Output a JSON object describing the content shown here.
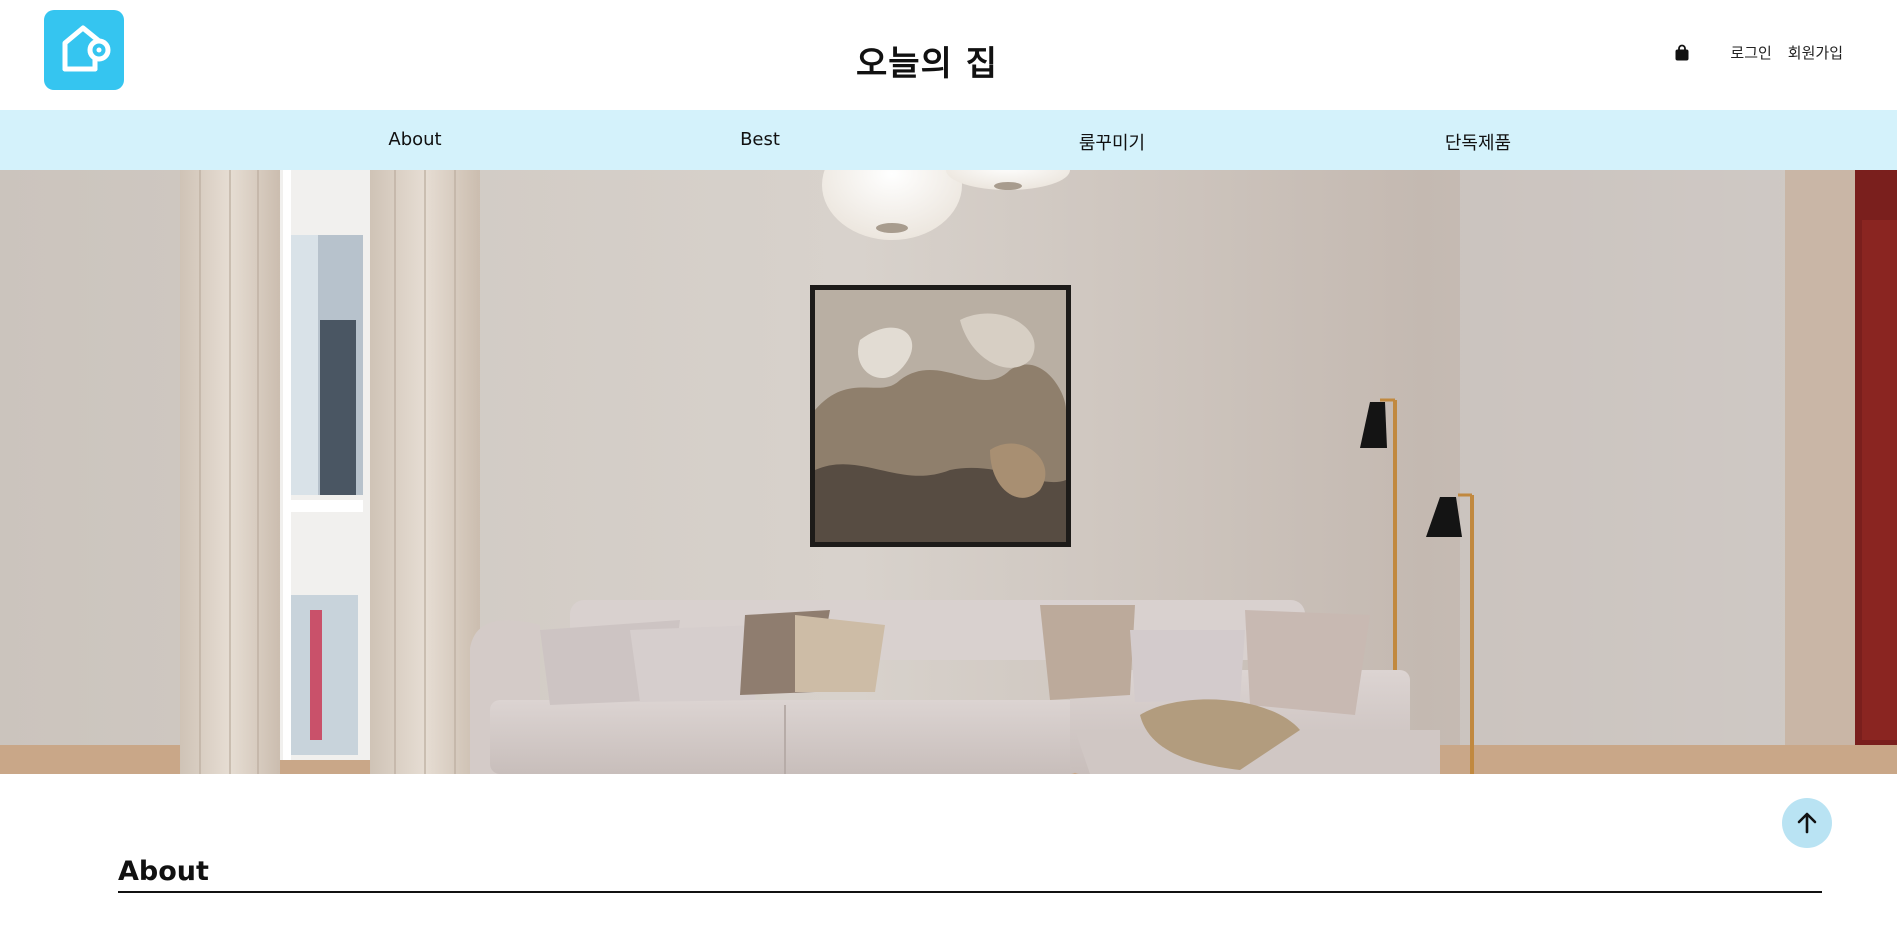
{
  "header": {
    "title": "오늘의 집",
    "logo_icon": "home-pin-logo-icon",
    "logo_color": "#35c5f0",
    "cart_icon": "shopping-bag-icon",
    "login_label": "로그인",
    "signup_label": "회원가입"
  },
  "nav": {
    "background": "#d4f2fb",
    "items": [
      {
        "label": "About"
      },
      {
        "label": "Best"
      },
      {
        "label": "룸꾸미기"
      },
      {
        "label": "단독제품"
      }
    ]
  },
  "hero": {
    "image": "living-room-hero-image"
  },
  "scroll_top": {
    "icon": "arrow-up-icon",
    "color": "#b9e3f3"
  },
  "section": {
    "title": "About"
  }
}
